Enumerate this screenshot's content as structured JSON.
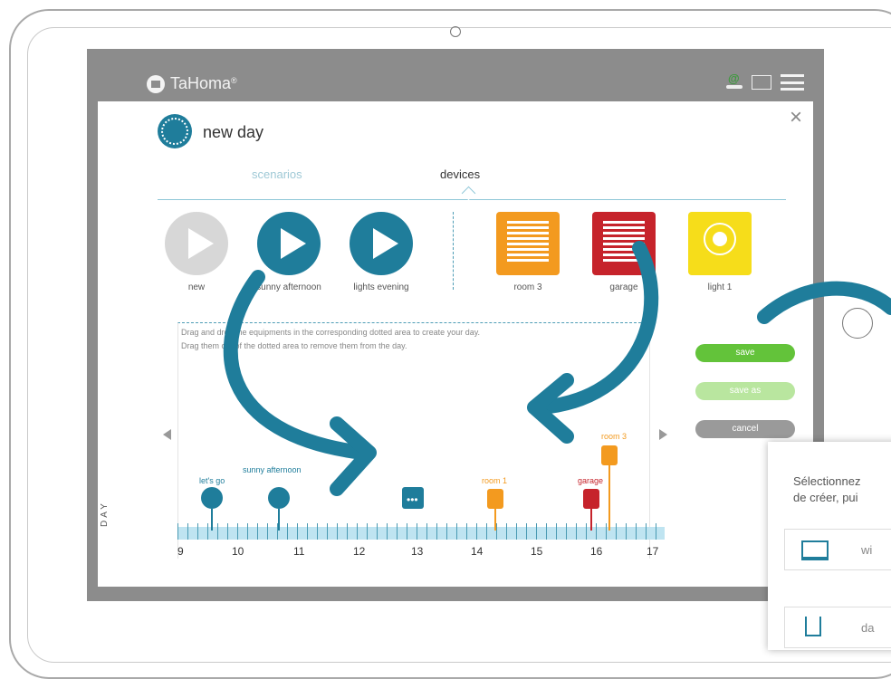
{
  "app": {
    "brand": "TaHoma",
    "brand_mark": "®"
  },
  "header": {
    "title": "new day",
    "close_glyph": "×"
  },
  "tabs": [
    {
      "label": "scenarios"
    },
    {
      "label": "devices"
    }
  ],
  "scenarios": [
    {
      "label": "new",
      "color": "#d7d7d7"
    },
    {
      "label": "sunny afternoon",
      "color": "#1f7d9b"
    },
    {
      "label": "lights evening",
      "color": "#1f7d9b"
    }
  ],
  "devices": [
    {
      "label": "room 3",
      "color": "#f39a1f",
      "icon": "blind-icon"
    },
    {
      "label": "garage",
      "color": "#c6232b",
      "icon": "garage-icon"
    },
    {
      "label": "light 1",
      "color": "#f6dd1a",
      "icon": "bulb-icon"
    }
  ],
  "dropzone": {
    "hint1": "Drag and drop the equipments in the corresponding dotted area to create your day.",
    "hint2": "Drag them out of the dotted area to remove them from the day."
  },
  "buttons": {
    "save": "save",
    "save_as": "save as",
    "cancel": "cancel"
  },
  "timeline": {
    "day_label": "DAY",
    "ticks": [
      "9",
      "10",
      "11",
      "12",
      "13",
      "14",
      "15",
      "16",
      "17"
    ],
    "events": [
      {
        "label": "let's go",
        "type": "scenario"
      },
      {
        "label": "sunny afternoon",
        "type": "scenario"
      },
      {
        "label": "",
        "type": "more"
      },
      {
        "label": "room 1",
        "type": "blind"
      },
      {
        "label": "garage",
        "type": "garage"
      },
      {
        "label": "room 3",
        "type": "blind"
      }
    ]
  },
  "popup": {
    "line1": "Sélectionnez",
    "line2": "de créer, pui",
    "items": [
      {
        "label": "wi",
        "icon": "laptop-icon"
      },
      {
        "label": "da",
        "icon": "drink-icon"
      }
    ]
  },
  "colors": {
    "accent": "#1f7d9b",
    "save": "#63c33a",
    "save_as": "#b9e69f",
    "cancel": "#9a9a9a"
  }
}
